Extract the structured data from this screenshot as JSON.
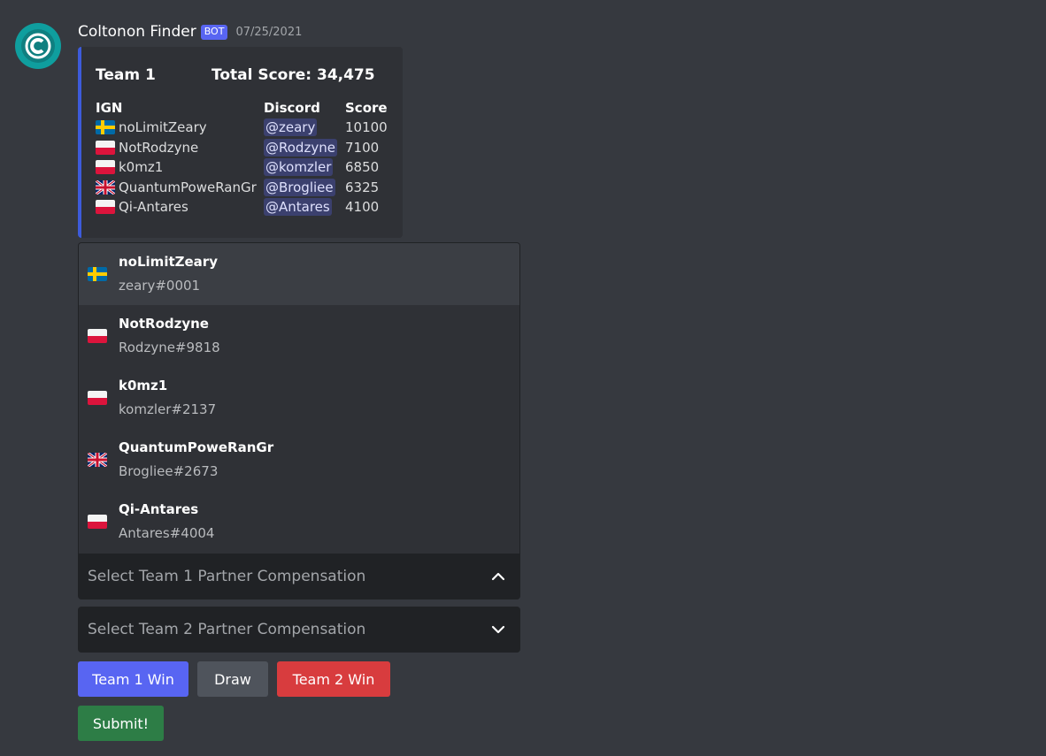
{
  "message": {
    "username": "Coltonon Finder",
    "badge": "BOT",
    "timestamp": "07/25/2021",
    "avatar_icon": "c-logo-icon",
    "avatar_color": "#0f9e9e"
  },
  "embed": {
    "accent_color": "#3d5bdb",
    "title": "Team 1",
    "total_score": "Total Score: 34,475",
    "headers": {
      "ign": "IGN",
      "discord": "Discord",
      "score": "Score"
    },
    "rows": [
      {
        "flag": "sweden-flag-icon",
        "ign": "noLimitZeary",
        "discord": "@zeary",
        "score": "10100"
      },
      {
        "flag": "poland-flag-icon",
        "ign": "NotRodzyne",
        "discord": "@Rodzyne",
        "score": "7100"
      },
      {
        "flag": "poland-flag-icon",
        "ign": "k0mz1",
        "discord": "@komzler",
        "score": "6850"
      },
      {
        "flag": "uk-flag-icon",
        "ign": "QuantumPoweRanGr",
        "discord": "@Brogliee",
        "score": "6325"
      },
      {
        "flag": "poland-flag-icon",
        "ign": "Qi-Antares",
        "discord": "@Antares",
        "score": "4100"
      }
    ]
  },
  "select_menu_1": {
    "placeholder": "Select Team 1 Partner Compensation",
    "expanded": true,
    "options": [
      {
        "flag": "sweden-flag-icon",
        "label": "noLimitZeary",
        "description": "zeary#0001"
      },
      {
        "flag": "poland-flag-icon",
        "label": "NotRodzyne",
        "description": "Rodzyne#9818"
      },
      {
        "flag": "poland-flag-icon",
        "label": "k0mz1",
        "description": "komzler#2137"
      },
      {
        "flag": "uk-flag-icon",
        "label": "QuantumPoweRanGr",
        "description": "Brogliee#2673"
      },
      {
        "flag": "poland-flag-icon",
        "label": "Qi-Antares",
        "description": "Antares#4004"
      }
    ]
  },
  "select_menu_2": {
    "placeholder": "Select Team 2 Partner Compensation",
    "expanded": false
  },
  "buttons": {
    "team1_win": "Team 1 Win",
    "draw": "Draw",
    "team2_win": "Team 2 Win",
    "submit": "Submit!"
  },
  "colors": {
    "primary": "#5865f2",
    "secondary": "#4f545c",
    "danger": "#d83c3e",
    "success": "#2d7d46"
  }
}
